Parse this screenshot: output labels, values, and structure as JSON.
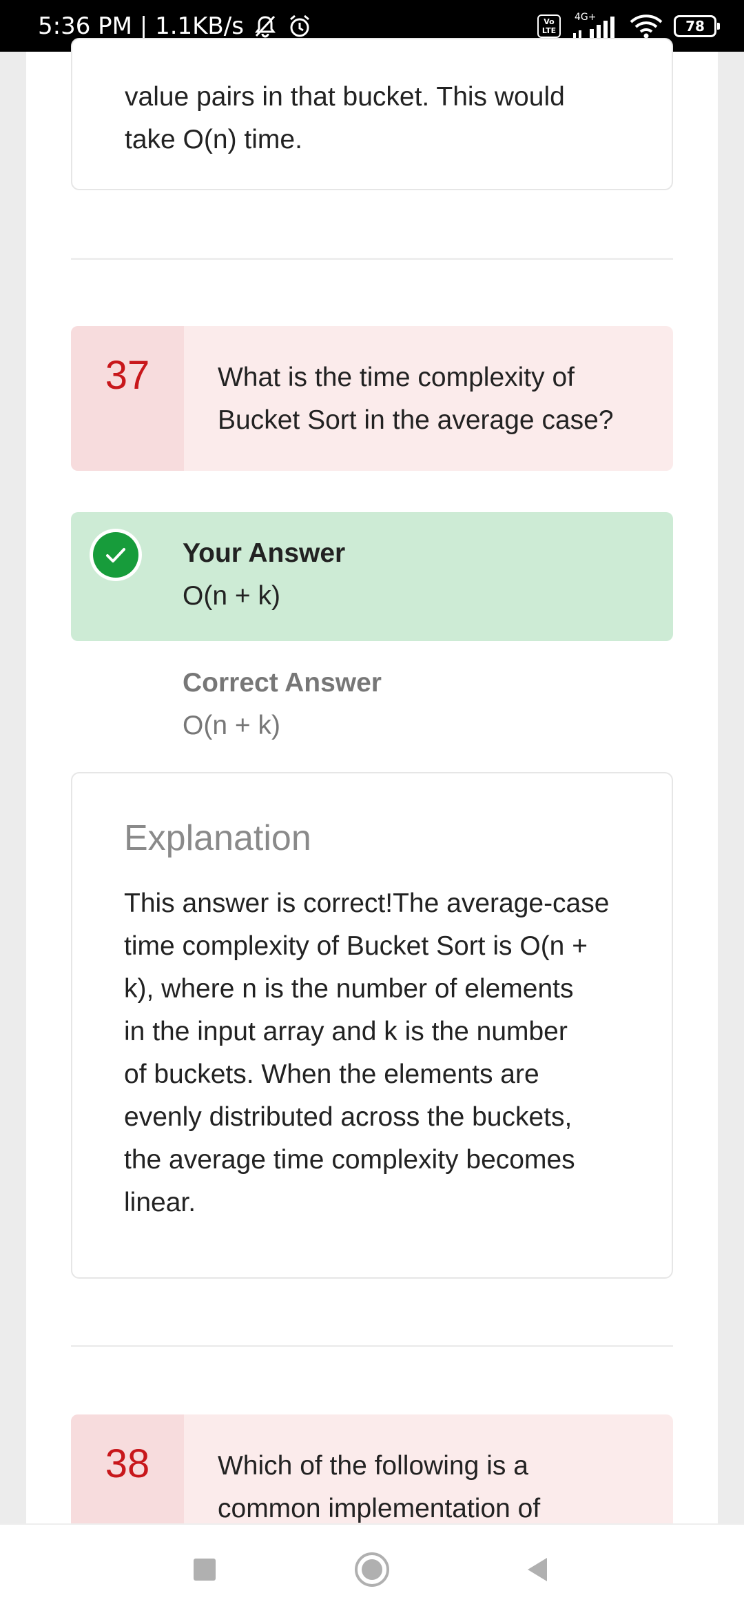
{
  "status_bar": {
    "time_speed": "5:36 PM | 1.1KB/s",
    "network": "4G+",
    "volte": "Vo LTE",
    "battery": "78"
  },
  "previous_answer": {
    "lines": [
      "value pairs in that bucket. This would",
      "take O(n) time."
    ]
  },
  "question_37": {
    "number": "37",
    "lines": [
      "What is the time complexity of",
      "Bucket Sort in the average case?"
    ]
  },
  "your_answer": {
    "label": "Your Answer",
    "value": "O(n + k)"
  },
  "correct_answer": {
    "label": "Correct Answer",
    "value": "O(n + k)"
  },
  "explanation": {
    "title": "Explanation",
    "lines": [
      "This answer is correct!The average-case",
      "time complexity of Bucket Sort is O(n +",
      "k), where n is the number of elements",
      "in the input array and k is the number",
      "of buckets. When the elements are",
      "evenly distributed across the buckets,",
      "the average time complexity becomes",
      "linear."
    ]
  },
  "question_38": {
    "number": "38",
    "lines": [
      "Which of the following is a",
      "common implementation of"
    ]
  },
  "colors": {
    "accent_red": "#c8171b",
    "correct_green": "#179c3b",
    "answer_bg": "#cdebd5",
    "question_bg": "#fbebeb"
  },
  "icons": {
    "nav_recents": "square-icon",
    "nav_home": "circle-icon",
    "nav_back": "triangle-back-icon"
  }
}
